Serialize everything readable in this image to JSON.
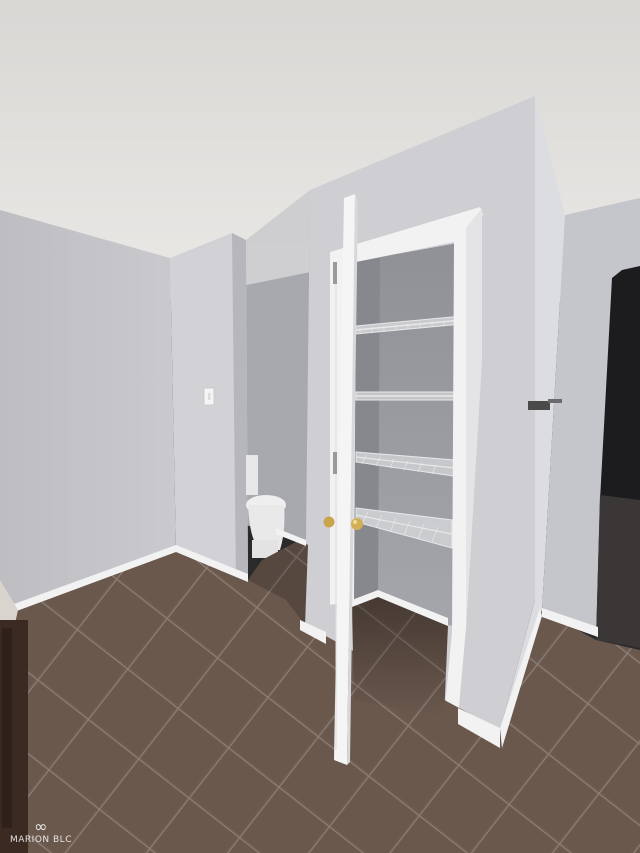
{
  "scene": {
    "ceiling_color": "#e6e4e1",
    "wall_color": "#cfcfd3",
    "wall_shadow_color": "#b9bac0",
    "closet_interior_color": "#9c9ea4",
    "trim_color": "#f3f3f3",
    "floor_tile_color": "#6b5a4f",
    "grout_color": "#8a7d73",
    "doorway_dark_color": "#1e1d1f",
    "toilet_color": "#ededed",
    "shelf_count": 4
  },
  "watermark": {
    "text": "MARION BLC"
  }
}
